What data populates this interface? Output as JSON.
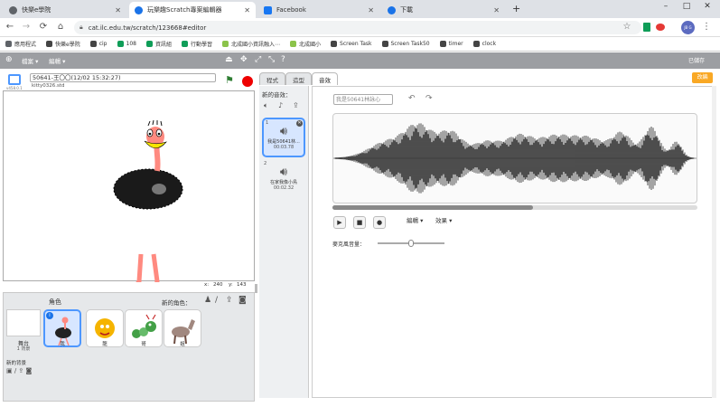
{
  "browser": {
    "tabs": [
      {
        "title": "快樂e學院",
        "color": "#5f6368",
        "active": false
      },
      {
        "title": "玩樂趣Scratch專案編輯器",
        "color": "#1a73e8",
        "active": true
      },
      {
        "title": "Facebook",
        "color": "#1877f2",
        "active": false
      },
      {
        "title": "下載",
        "color": "#1a73e8",
        "active": false
      }
    ],
    "new_tab_label": "+",
    "url": "cat.ilc.edu.tw/scratch/123668#editor",
    "window_controls": [
      "–",
      "□",
      "✕"
    ],
    "profile_initials": "JB G",
    "bookmarks": [
      {
        "label": "應用程式",
        "color": "#5f6368"
      },
      {
        "label": "快樂e學院",
        "color": "#444444"
      },
      {
        "label": "cip",
        "color": "#444444"
      },
      {
        "label": "108",
        "color": "#0f9d58"
      },
      {
        "label": "資訊組",
        "color": "#0f9d58"
      },
      {
        "label": "行動學習",
        "color": "#0f9d58"
      },
      {
        "label": "北成國小資訊融入⋯",
        "color": "#8bc34a"
      },
      {
        "label": "北成國小",
        "color": "#8bc34a"
      },
      {
        "label": "Screen Task",
        "color": "#444444"
      },
      {
        "label": "Screen Task50",
        "color": "#444444"
      },
      {
        "label": "timer",
        "color": "#444444"
      },
      {
        "label": "clock",
        "color": "#444444"
      }
    ]
  },
  "scratch": {
    "menu": {
      "file": "檔案 ▾",
      "edit": "編輯 ▾",
      "saved": "已儲存"
    },
    "project_title": "50641-王〇〇(12/02 15:32:27)",
    "owner": "kitty0326.std",
    "version": "v458.0.1",
    "stage_coords": {
      "x_label": "x:",
      "x_value": "240",
      "y_label": "y:",
      "y_value": "143"
    },
    "sprites_pane": {
      "title": "角色",
      "new_sprite_label": "新的角色：",
      "stage_label": "舞台",
      "stage_backdrops": "1 背景",
      "new_backdrop_label": "新的背景",
      "sprites": [
        {
          "name": "我"
        },
        {
          "name": "龍"
        },
        {
          "name": "哥"
        },
        {
          "name": "姐"
        }
      ]
    },
    "editor_tabs": [
      "程式",
      "造型",
      "音效"
    ],
    "active_tab": "音效",
    "new_sound_label": "新的音效：",
    "sounds": [
      {
        "index": "1",
        "name": "我是50641林...",
        "duration": "00:03.78",
        "selected": true
      },
      {
        "index": "2",
        "name": "在家我像小鳥",
        "duration": "00:02.32",
        "selected": false
      }
    ],
    "sound_name_value": "我是50641林詠心",
    "edit_menu": "編輯 ▾",
    "effects_menu": "效果 ▾",
    "mic_volume_label": "麥克風音量：",
    "mic_volume_level": 0.5,
    "scroll_position": 0.55,
    "remix_label": "改編",
    "accent_color": "#4d97ff",
    "menubar_color": "#9c9ea2",
    "remix_color": "#f9a825"
  }
}
